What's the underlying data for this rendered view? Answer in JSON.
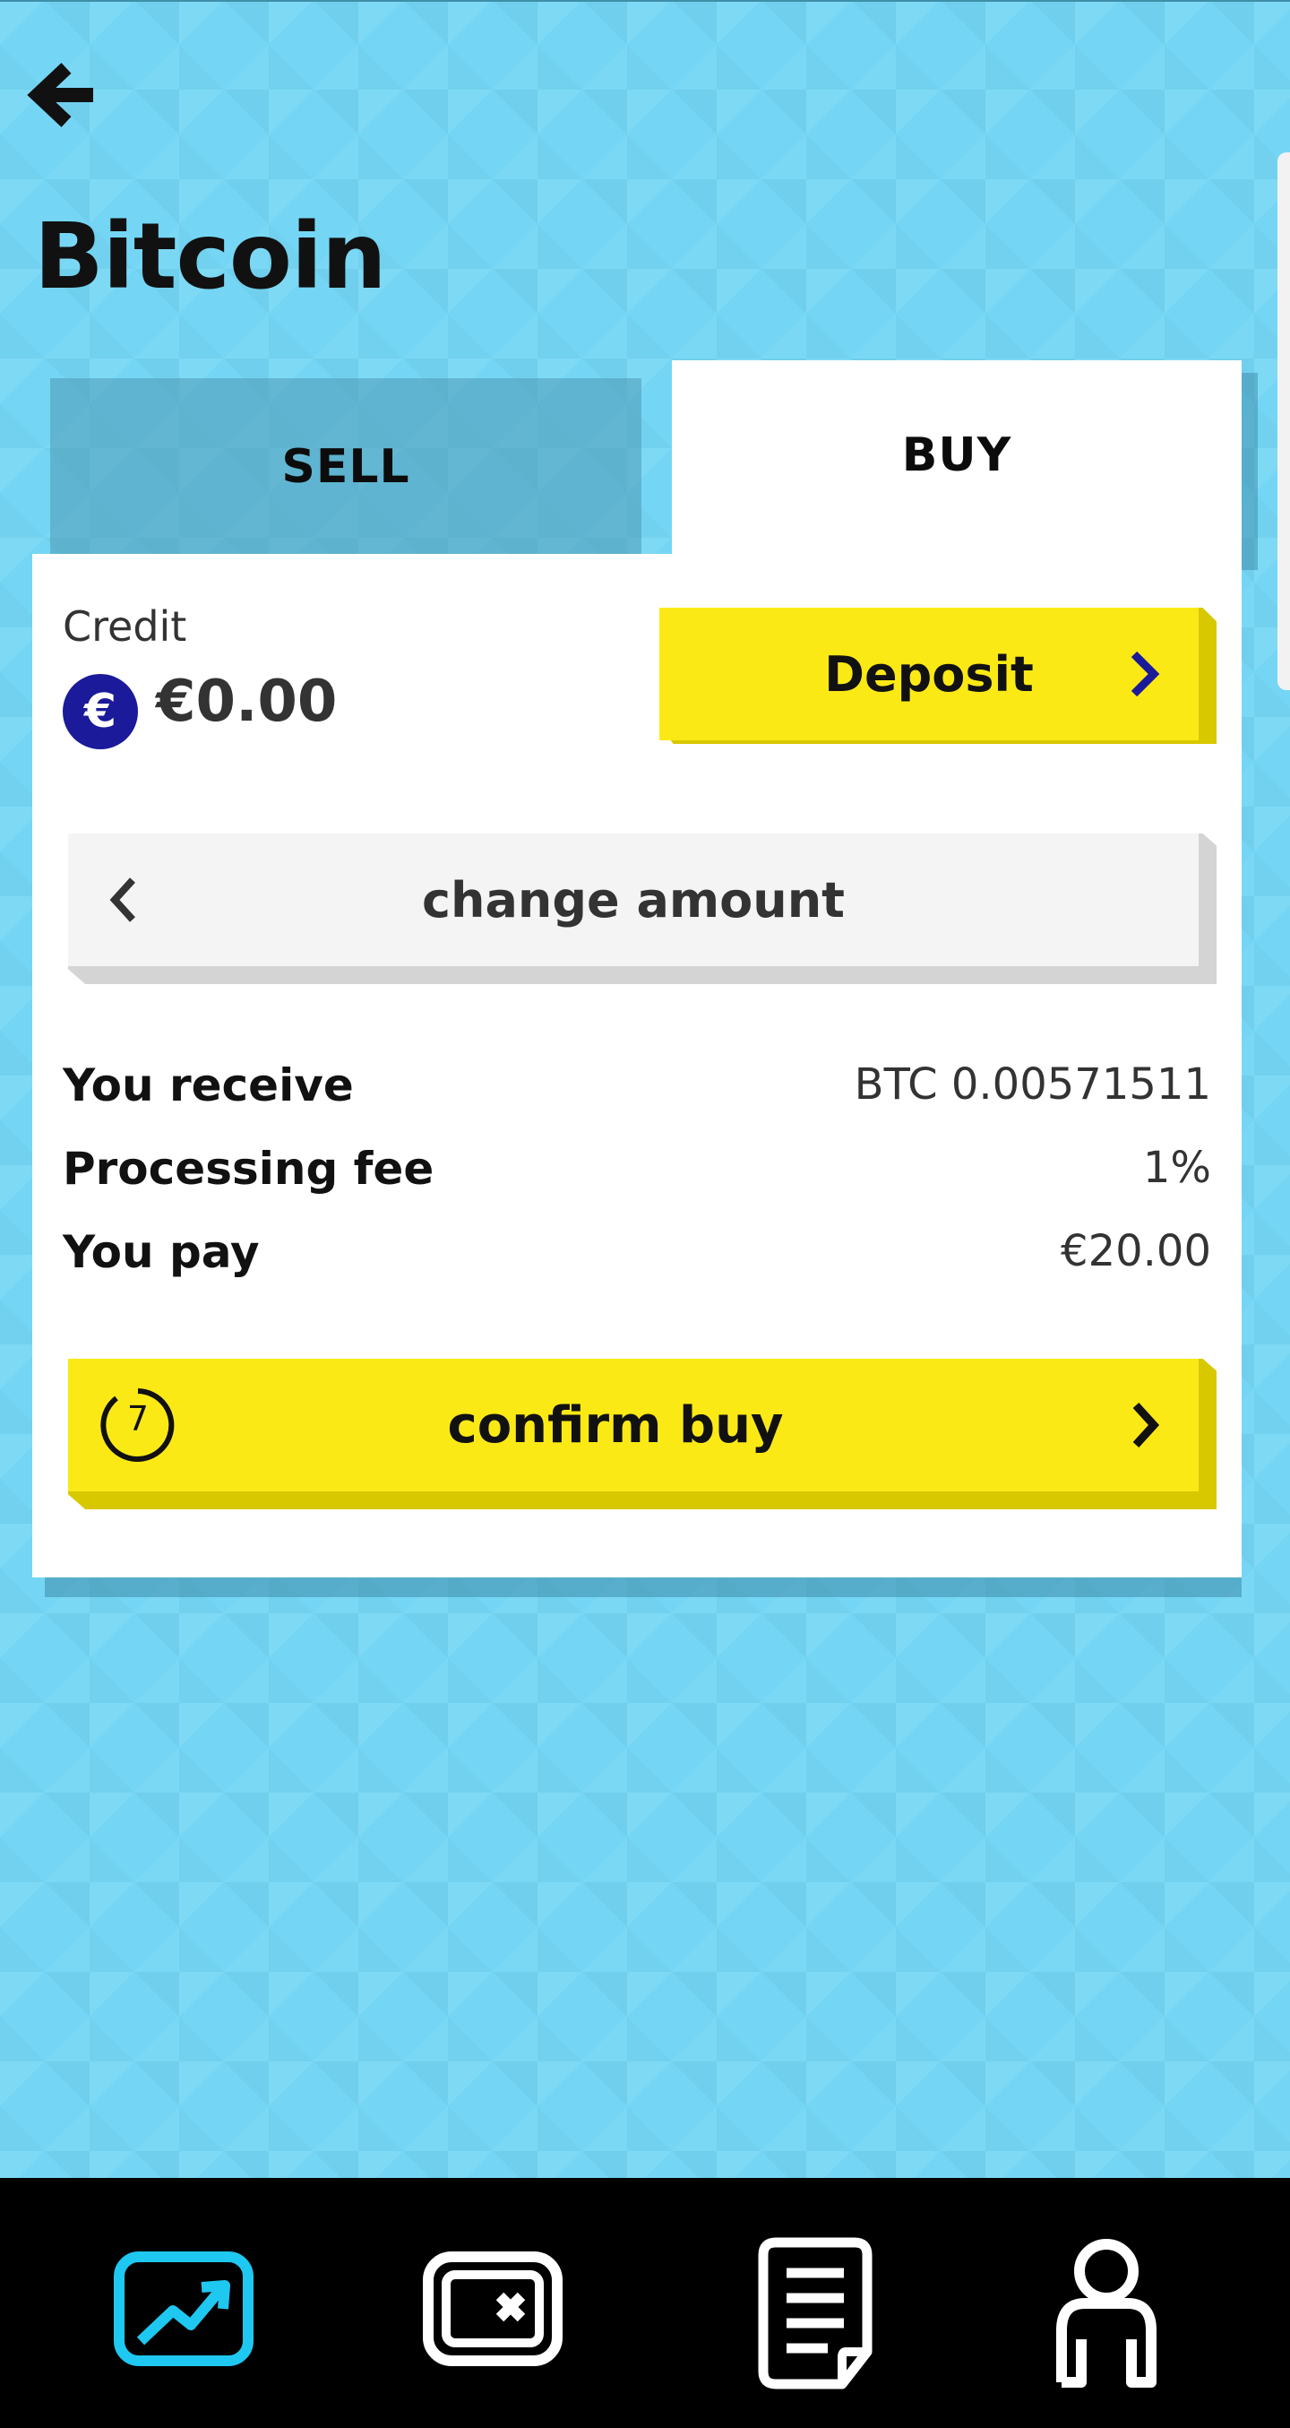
{
  "header": {
    "title": "Bitcoin"
  },
  "tabs": {
    "sell": "SELL",
    "buy": "BUY",
    "active": "BUY"
  },
  "credit": {
    "label": "Credit",
    "currency_symbol": "€",
    "value": "€0.00"
  },
  "buttons": {
    "deposit": "Deposit",
    "change_amount": "change amount",
    "confirm_buy": "confirm buy"
  },
  "summary": [
    {
      "label": "You receive",
      "value": "BTC 0.00571511"
    },
    {
      "label": "Processing fee",
      "value": "1%"
    },
    {
      "label": "You pay",
      "value": "€20.00"
    }
  ],
  "timer": {
    "value": "7"
  },
  "nav": {
    "items": [
      {
        "name": "chart-icon",
        "active": true
      },
      {
        "name": "wallet-icon",
        "active": false
      },
      {
        "name": "document-icon",
        "active": false
      },
      {
        "name": "profile-icon",
        "active": false
      }
    ],
    "active_color": "#1ec8f0"
  },
  "colors": {
    "background": "#74d6f4",
    "accent_yellow": "#fbe916",
    "euro_badge": "#1a1a9a"
  }
}
